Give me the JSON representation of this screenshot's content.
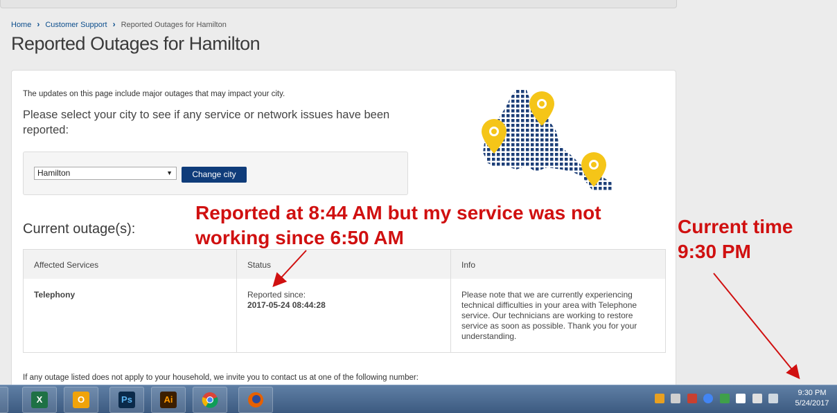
{
  "breadcrumb": {
    "home": "Home",
    "support": "Customer Support",
    "current": "Reported Outages for Hamilton"
  },
  "page_title": "Reported Outages for Hamilton",
  "intro": {
    "small": "The updates on this page include major outages that may impact your city.",
    "large": "Please select your city to see if any service or network issues have been reported:"
  },
  "city_select": {
    "value": "Hamilton",
    "button_label": "Change city"
  },
  "outages": {
    "heading": "Current outage(s):",
    "columns": [
      "Affected Services",
      "Status",
      "Info"
    ],
    "rows": [
      {
        "service": "Telephony",
        "status_label": "Reported since:",
        "status_time": "2017-05-24 08:44:28",
        "info": "Please note that we are currently experiencing technical difficulties in your area with Telephone service. Our technicians are working to restore service as soon as possible. Thank you for your understanding."
      }
    ]
  },
  "bottom_note": "If any outage listed does not apply to your household, we invite you to contact us at one of the following number:",
  "annotations": {
    "reported": "Reported at 8:44 AM but my service was not working since 6:50 AM",
    "current_time_label": "Current time",
    "current_time_value": "9:30 PM"
  },
  "taskbar": {
    "apps": [
      "excel-icon",
      "outlook-icon",
      "photoshop-icon",
      "illustrator-icon",
      "chrome-icon",
      "firefox-icon"
    ],
    "ps_text": "Ps",
    "ai_text": "Ai",
    "clock_time": "9:30 PM",
    "clock_date": "5/24/2017"
  },
  "colors": {
    "brand_blue": "#0f3c7a",
    "annotation_red": "#d01010",
    "pin_yellow": "#f5c518"
  }
}
